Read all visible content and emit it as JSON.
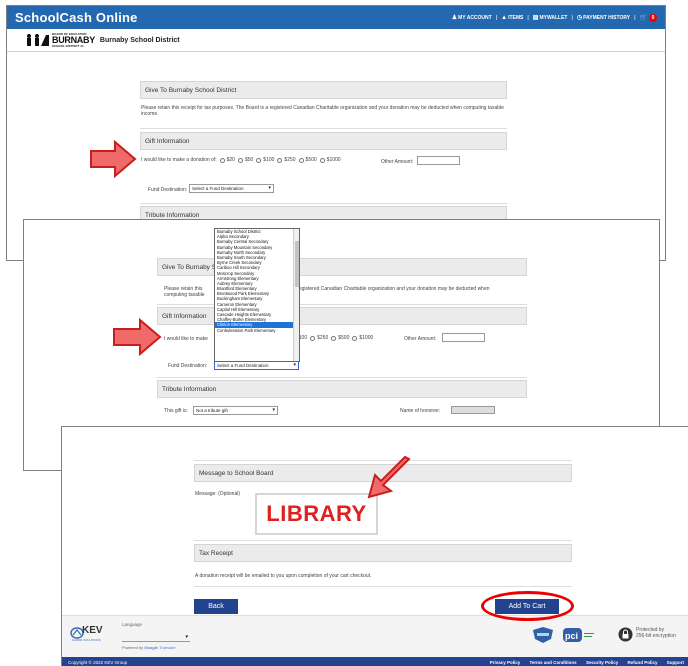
{
  "header": {
    "brand": "SchoolCash Online",
    "nav": [
      {
        "icon": "person-icon",
        "label": "MY ACCOUNT"
      },
      {
        "icon": "items-icon",
        "label": "ITEMS"
      },
      {
        "icon": "wallet-icon",
        "label": "MYWALLET"
      },
      {
        "icon": "history-icon",
        "label": "PAYMENT HISTORY"
      }
    ],
    "cart_count": "0"
  },
  "district": {
    "logo_small": "BOARD OF EDUCATION",
    "logo_big": "BURNABY",
    "logo_sub": "SCHOOL DISTRICT 41",
    "name": "Burnaby School District"
  },
  "form": {
    "give_title": "Give To Burnaby School District",
    "receipt_note": "Please retain this receipt for tax purposes. The Board is a registered Canadian Charitable organization and your donation may be deducted when computing taxable income.",
    "receipt_note_short": "Please retain this",
    "receipt_note_tail": "is a registered Canadian Charitable organization and your donation may be deducted when",
    "computing_taxable": "computing taxable",
    "gift_title": "Gift Information",
    "donation_prompt": "I would like to make a donation of:",
    "donation_prompt_short": "I would like to make",
    "amounts": [
      "$20",
      "$50",
      "$100",
      "$250",
      "$500",
      "$1000"
    ],
    "other_amount_label": "Other Amount:",
    "fund_destination_label": "Fund Destination:",
    "fund_destination_placeholder": "Select a Fund Destination",
    "tribute_title": "Tribute Information",
    "tribute_label": "This gift is:",
    "tribute_value": "Not a tribute gift",
    "honoree_label": "Name of honoree:",
    "message_title": "Message to School Board",
    "message_label": "Message: (Optional)",
    "message_value": "LIBRARY",
    "tax_title": "Tax Receipt",
    "tax_note": "A donation receipt will be emailed to you upon completion of your cart checkout."
  },
  "fund_options": [
    "Burnaby School District",
    "Alpha Secondary",
    "Burnaby Central Secondary",
    "Burnaby Mountain Secondary",
    "Burnaby North Secondary",
    "Burnaby South Secondary",
    "Byrne Creek Secondary",
    "Cariboo Hill Secondary",
    "Moscrop Secondary",
    "Armstrong Elementary",
    "Aubrey Elementary",
    "Brantford Elementary",
    "Brentwood Park Elementary",
    "Buckingham Elementary",
    "Cameron Elementary",
    "Capitol Hill Elementary",
    "Cascade Heights Elementary",
    "Chaffey-Burke Elementary",
    "Clinton Elementary",
    "Confederation Park Elementary"
  ],
  "fund_selected_index": 18,
  "buttons": {
    "back": "Back",
    "add_to_cart": "Add To Cart"
  },
  "footer": {
    "language_label": "Language",
    "powered_by": "Powered by",
    "google": "Google",
    "translate": "Translate",
    "kev_name": "KEV",
    "kev_sub": "KARMA SOLUTIONS",
    "protected_label": "Protected by",
    "encryption_label": "256-bit encryption",
    "copyright": "Copyright © 2022 KEV Group",
    "links": [
      "Privacy Policy",
      "Terms and Conditions",
      "Security Policy",
      "Refund Policy",
      "Support"
    ]
  },
  "colors": {
    "header_blue": "#2468b0",
    "button_navy": "#23438e",
    "annotation_red": "#e02020",
    "selected_option": "#1e73d8"
  }
}
